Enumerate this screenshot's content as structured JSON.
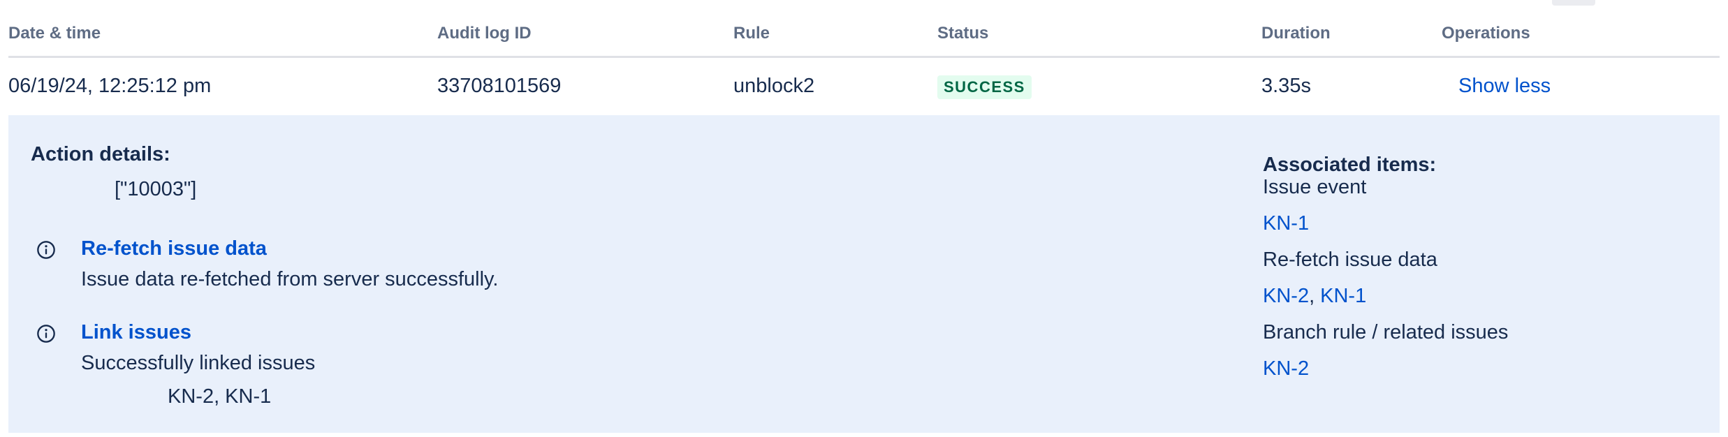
{
  "table": {
    "headers": {
      "date_time": "Date & time",
      "audit_log_id": "Audit log ID",
      "rule": "Rule",
      "status": "Status",
      "duration": "Duration",
      "operations": "Operations"
    },
    "row": {
      "date_time": "06/19/24, 12:25:12 pm",
      "audit_log_id": "33708101569",
      "rule": "unblock2",
      "status": "SUCCESS",
      "duration": "3.35s",
      "operation": "Show less"
    }
  },
  "details": {
    "action_details_title": "Action details:",
    "action_details_value": "[\"10003\"]",
    "steps": [
      {
        "icon": "info-icon",
        "title": "Re-fetch issue data",
        "description": "Issue data re-fetched from server successfully.",
        "sub": ""
      },
      {
        "icon": "info-icon",
        "title": "Link issues",
        "description": "Successfully linked issues",
        "sub": "KN-2, KN-1"
      }
    ],
    "associated": {
      "title": "Associated items:",
      "groups": [
        {
          "label": "Issue event",
          "links": [
            "KN-1"
          ],
          "separators": []
        },
        {
          "label": "Re-fetch issue data",
          "links": [
            "KN-2",
            "KN-1"
          ],
          "separators": [
            ","
          ]
        },
        {
          "label": "Branch rule / related issues",
          "links": [
            "KN-2"
          ],
          "separators": []
        }
      ]
    }
  },
  "colors": {
    "link": "#0052cc",
    "text": "#172b4d",
    "header_text": "#5e6c84",
    "panel_bg": "#e9f0fb",
    "success_bg": "#e3fcef",
    "success_text": "#006644"
  }
}
